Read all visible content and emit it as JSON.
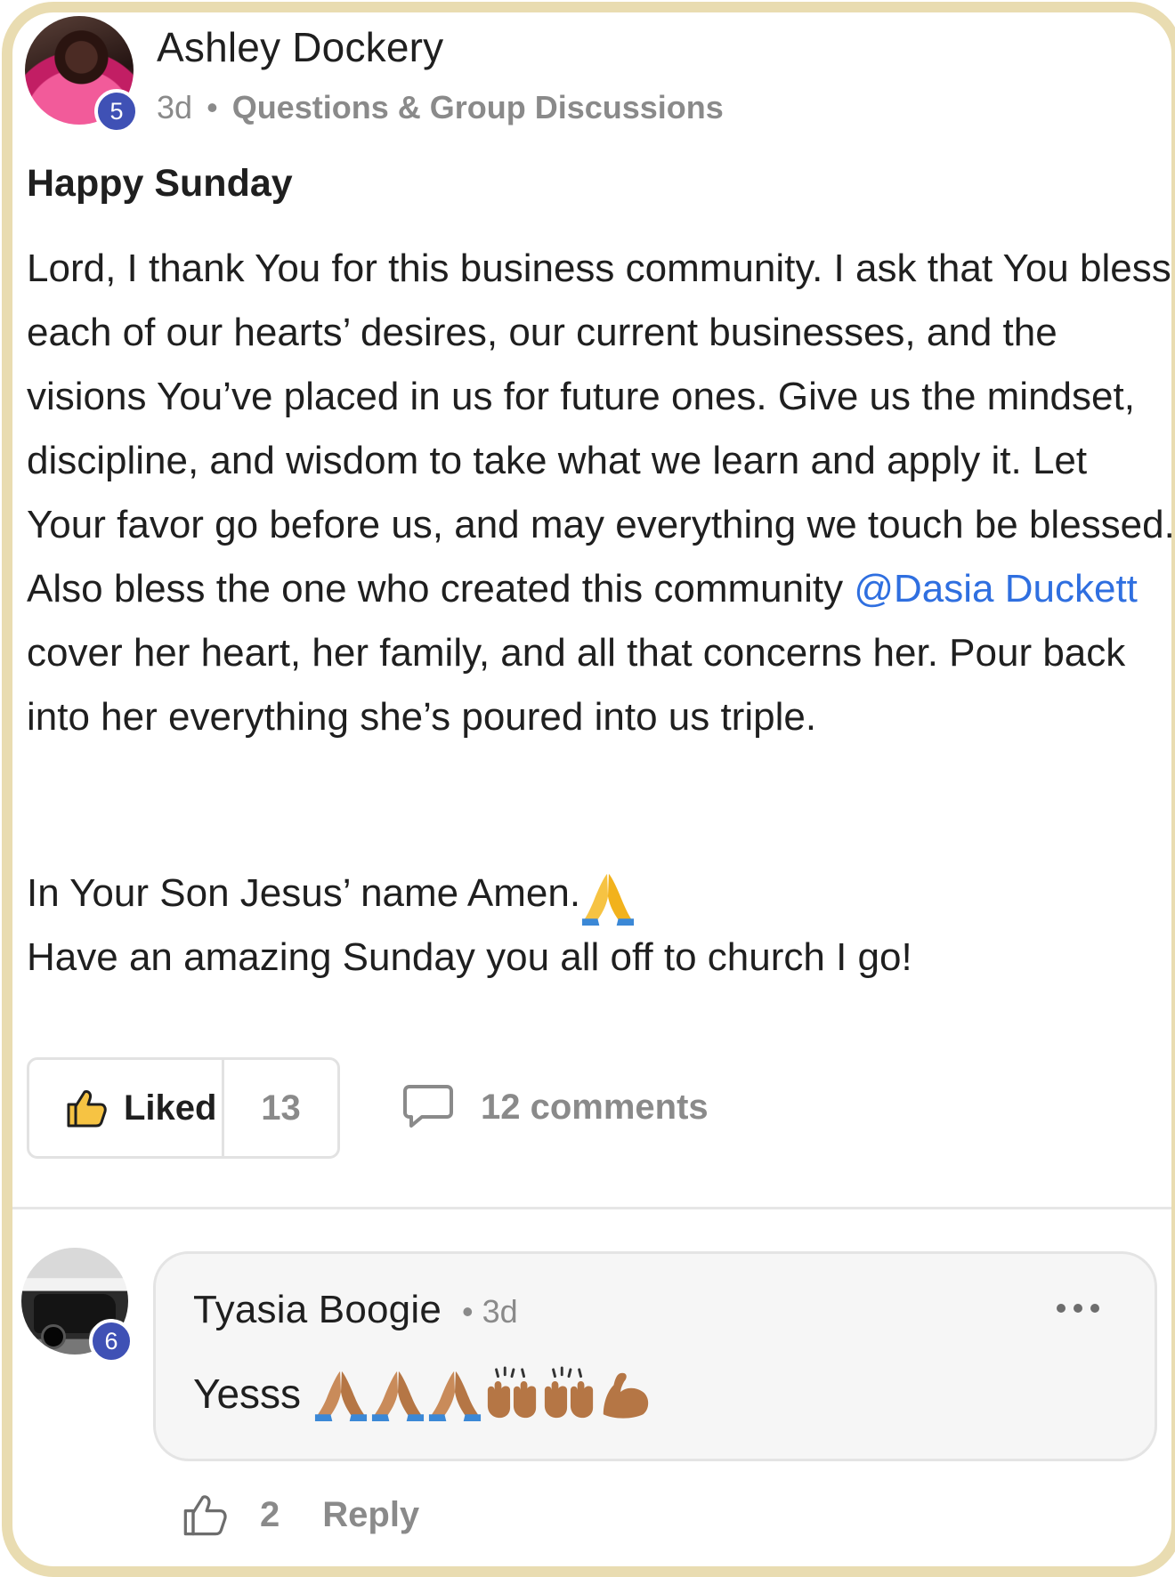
{
  "post": {
    "author": "Ashley Dockery",
    "level_badge": "5",
    "time": "3d",
    "separator": "•",
    "group": "Questions & Group Discussions",
    "title": "Happy Sunday",
    "body_before_mention": "Lord, I thank You for this business community. I ask that You bless each of our hearts’ desires, our current businesses, and the visions You’ve placed in us for future ones. Give us the mindset, discipline, and wisdom to take what we learn and apply it. Let Your favor go before us, and may everything we touch be blessed. Also bless the one who created this community ",
    "mention": "@Dasia Duckett",
    "body_after_mention": " cover her heart, her family, and all that concerns her. Pour back into her everything she’s poured into us triple.",
    "closing_line_1": "In Your Son Jesus’ name Amen.",
    "closing_line_2": "Have an amazing Sunday you all off to church I go!",
    "closing_emoji": "folded-hands-emoji",
    "like_label": "Liked",
    "like_count": "13",
    "comments_label": "12 comments"
  },
  "comment": {
    "author": "Tyasia Boogie",
    "level_badge": "6",
    "time": "3d",
    "separator": "•",
    "text": "Yesss",
    "emojis": [
      "folded-hands-emoji",
      "folded-hands-emoji",
      "folded-hands-emoji",
      "raising-hands-emoji",
      "raising-hands-emoji",
      "flexed-biceps-emoji"
    ],
    "like_count": "2",
    "reply_label": "Reply"
  },
  "colors": {
    "frame_border": "#e9dcb1",
    "badge": "#3f51b5",
    "mention": "#2f6fe0",
    "muted_text": "#8a8a8a",
    "liked_thumb": "#f6c343"
  }
}
